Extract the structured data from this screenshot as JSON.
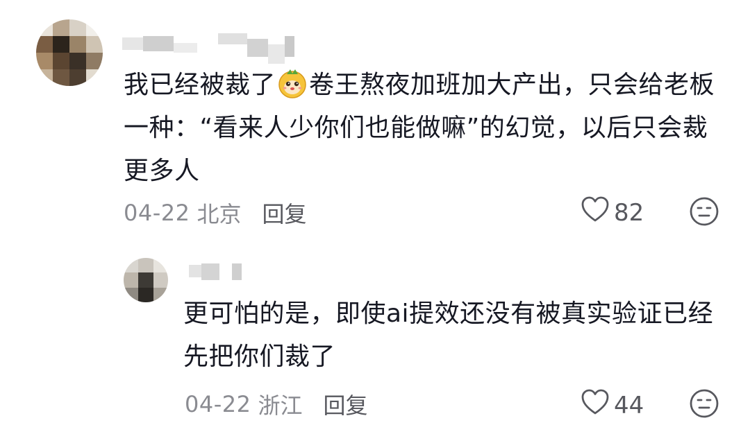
{
  "comment": {
    "avatar_icon": "pixelated-avatar",
    "text_before_emoji": "我已经被裁了",
    "emoji_icon": "orange-monkey-emoji",
    "text_after_emoji": "卷王熬夜加班加大产出，只会给老板一种：“看来人少你们也能做嘛”的幻觉，以后只会裁更多人",
    "date": "04-22",
    "location": "北京",
    "reply_label": "回复",
    "like_count": "82",
    "dislike_icon": "neutral-face-icon"
  },
  "reply": {
    "avatar_icon": "pixelated-avatar",
    "text": "更可怕的是，即使ai提效还没有被真实验证已经先把你们裁了",
    "date": "04-22",
    "location": "浙江",
    "reply_label": "回复",
    "like_count": "44",
    "dislike_icon": "neutral-face-icon"
  },
  "colors": {
    "text": "#161823",
    "meta": "#8a8b91",
    "action": "#57585e"
  }
}
